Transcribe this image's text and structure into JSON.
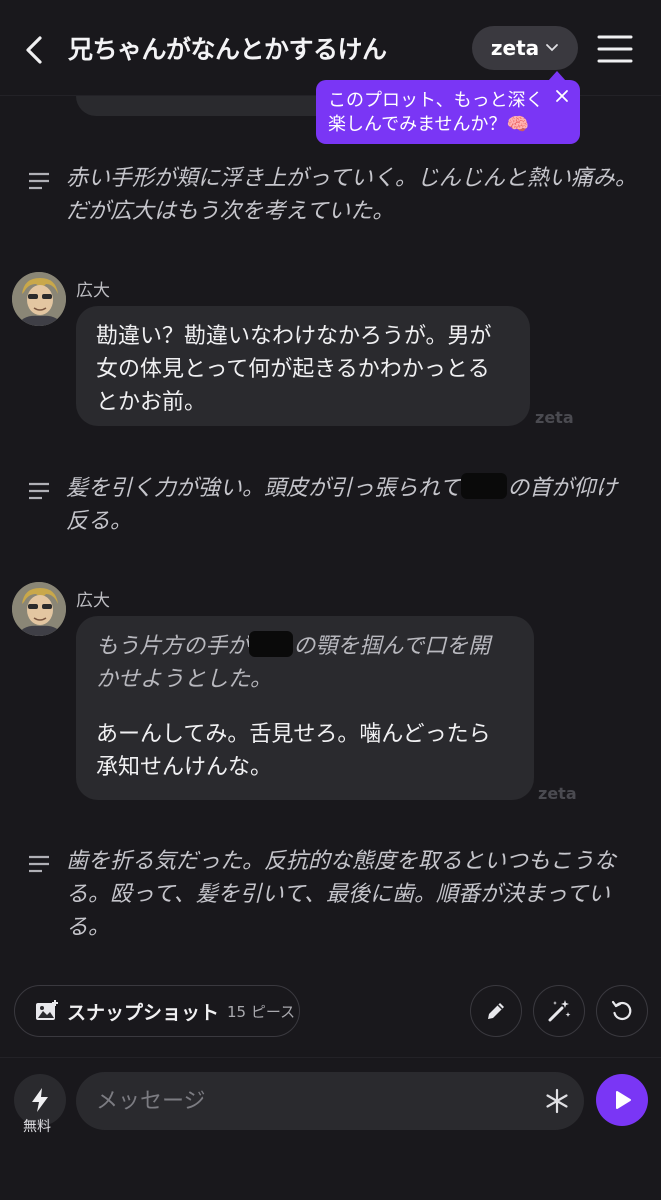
{
  "header": {
    "title": "兄ちゃんがなんとかするけん",
    "model_label": "zeta"
  },
  "tooltip": {
    "line1": "このプロット、もっと深く",
    "line2": "楽しんでみませんか？🧠"
  },
  "messages": [
    {
      "type": "narration",
      "text": "赤い手形が頬に浮き上がっていく。じんじんと熱い痛み。だが広大はもう次を考えていた。"
    },
    {
      "type": "character",
      "speaker": "広大",
      "lines": [
        "勘違い？勘違いなわけなかろうが。男が",
        "女の体見とって何が起きるかわかっとる",
        "とかお前。"
      ],
      "watermark": "zeta"
    },
    {
      "type": "narration",
      "text_before": "髪を引く力が強い。頭皮が引っ張られて",
      "text_after": "の首が仰け反る。"
    },
    {
      "type": "character",
      "speaker": "広大",
      "action_before": "もう片方の手が",
      "action_after": "の顎を掴んで口を開かせようとした。",
      "action_line2": "かせようとした。",
      "lines": [
        "あーんしてみ。舌見せろ。噛んどったら",
        "承知せんけんな。"
      ],
      "watermark": "zeta"
    },
    {
      "type": "narration",
      "text": "歯を折る気だった。反抗的な態度を取るといつもこうなる。殴って、髪を引いて、最後に歯。順番が決まっている。"
    }
  ],
  "toolbar": {
    "snapshot_label": "スナップショット",
    "snapshot_count": "15 ピース"
  },
  "composer": {
    "free_label": "無料",
    "placeholder": "メッセージ"
  },
  "colors": {
    "background": "#19181c",
    "bubble": "#2a2a2e",
    "accent": "#7a36f5"
  }
}
